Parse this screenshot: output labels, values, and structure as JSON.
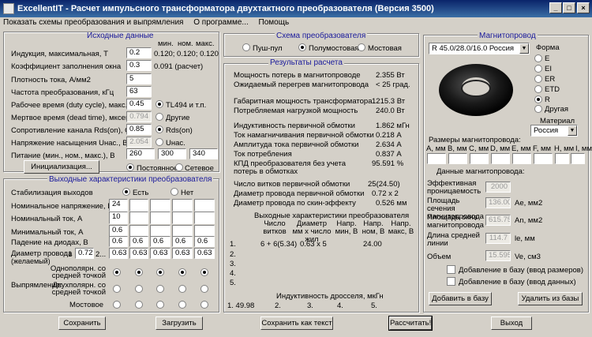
{
  "window": {
    "title": "ExcellentIT - Расчет импульсного трансформатора двухтактного преобразователя (Версия 3500)"
  },
  "menu": [
    "Показать схемы преобразования и выпрямления",
    "О программе...",
    "Помощь"
  ],
  "input_panel": {
    "title": "Исходные данные",
    "col_headers": [
      "мин.",
      "ном.",
      "макс."
    ],
    "rows": [
      {
        "label": "Индукция, максимальная, Т",
        "value": "0.2",
        "extra": "0.120; 0.120; 0.120"
      },
      {
        "label": "Коэффициент заполнения окна",
        "value": "0.3",
        "extra": "0.091 (расчет)"
      },
      {
        "label": "Плотность тока, А/мм2",
        "value": "5"
      },
      {
        "label": "Частота преобразования, кГц",
        "value": "63"
      },
      {
        "label": "Рабочее время (duty cycle), макс.",
        "value": "0.45"
      },
      {
        "label": "Мертвое время (dead time), мксек",
        "value": "0.794"
      },
      {
        "label": "Сопротивление канала Rds(on), Ом",
        "value": "0.85"
      },
      {
        "label": "Напряжение насыщения Uнас., В",
        "value": "2.054"
      }
    ],
    "opt1": [
      "TL494 и т.п.",
      "Другие"
    ],
    "opt2": [
      "Rds(on)",
      "Uнас."
    ],
    "supply_label": "Питание (мин., ном., макс.), В",
    "supply": [
      "260",
      "300",
      "340"
    ],
    "init_button": "Инициализация...",
    "supply_type": [
      "Постоянное",
      "Сетевое"
    ]
  },
  "output_panel": {
    "title": "Выходные характеристики преобразователя",
    "stab_label": "Стабилизация выходов",
    "stab_opts": [
      "Есть",
      "Нет"
    ],
    "rows": [
      {
        "label": "Номинальное напряжение, В",
        "values": [
          "24",
          "",
          "",
          "",
          ""
        ]
      },
      {
        "label": "Номинальный ток, А",
        "values": [
          "10",
          "",
          "",
          "",
          ""
        ]
      },
      {
        "label": "Минимальный ток, А",
        "values": [
          "0.6",
          "",
          "",
          "",
          ""
        ]
      },
      {
        "label": "Падение на диодах, В",
        "values": [
          "0.6",
          "0.6",
          "0.6",
          "0.6",
          "0.6"
        ]
      }
    ],
    "wire_label": "Диаметр провода",
    "wire_label2": "(желаемый)",
    "wire_values": [
      "1",
      "0.72",
      "2...",
      "0.63",
      "0.63",
      "0.63",
      "0.63",
      "0.63"
    ],
    "rect_label": "Выпрямление:",
    "rect_opts": [
      "Однополярн. со средней точкой",
      "Двухполярн. со средней точкой",
      "Мостовое"
    ]
  },
  "scheme": {
    "title": "Схема преобразователя",
    "opts": [
      "Пуш-пул",
      "Полумостовая",
      "Мостовая"
    ]
  },
  "results": {
    "title": "Результаты расчета",
    "rows": [
      {
        "label": "Мощность потерь в магнитопроводе",
        "value": "2.355 Вт"
      },
      {
        "label": "Ожидаемый перегрев магнитопровода",
        "value": "< 25 град."
      },
      {
        "label": "Габаритная мощность трансформатора",
        "value": "1215.3 Вт"
      },
      {
        "label": "Потребляемая нагрузкой мощность",
        "value": "240.0 Вт"
      },
      {
        "label": "Индуктивность первичной обмотки",
        "value": "1.862 мГн"
      },
      {
        "label": "Ток намагничивания первичной обмотки",
        "value": "0.218 А"
      },
      {
        "label": "Амплитуда тока первичной обмотки",
        "value": "2.634 А"
      },
      {
        "label": "Ток потребления",
        "value": "0.837 А"
      },
      {
        "label": "КПД преобразователя без учета",
        "value": "95.591 %"
      },
      {
        "label": "потерь в обмотках",
        "value": ""
      },
      {
        "label": "Число витков первичной обмотки",
        "value": "25(24.50)"
      },
      {
        "label": "Диаметр провода первичной обмотки",
        "value": "0.72 x 2"
      },
      {
        "label": "Диаметр провода по скин-эффекту",
        "value": "0.526 мм"
      }
    ],
    "out_title": "Выходные характеристики преобразователя",
    "out_cols": [
      "Число витков",
      "Диаметр мм x число жил",
      "Напр. мин, В",
      "Напр. ном, В",
      "Напр. макс, В"
    ],
    "out_rows": [
      {
        "n": "1.",
        "turns": "6 + 6(5.34)",
        "wire": "0.63 x 5",
        "vmin": "",
        "vnom": "24.00",
        "vmax": ""
      },
      {
        "n": "2.",
        "turns": "",
        "wire": "",
        "vmin": "",
        "vnom": "",
        "vmax": ""
      },
      {
        "n": "3.",
        "turns": "",
        "wire": "",
        "vmin": "",
        "vnom": "",
        "vmax": ""
      },
      {
        "n": "4.",
        "turns": "",
        "wire": "",
        "vmin": "",
        "vnom": "",
        "vmax": ""
      },
      {
        "n": "5.",
        "turns": "",
        "wire": "",
        "vmin": "",
        "vnom": "",
        "vmax": ""
      }
    ],
    "choke_title": "Индуктивность дросселя, мкГн",
    "choke": [
      "1. 49.98",
      "2.",
      "3.",
      "4.",
      "5."
    ]
  },
  "core": {
    "title": "Магнитопровод",
    "selected": "R 45.0/28.0/16.0 Россия",
    "shape_label": "Форма",
    "shapes": [
      "E",
      "EI",
      "ER",
      "ETD",
      "R",
      "Другая"
    ],
    "material_label": "Материал",
    "material": "Россия",
    "dims_label": "Размеры магнитопровода:",
    "dims_cols": [
      "A, мм",
      "B, мм",
      "C, мм",
      "D, мм",
      "E, мм",
      "F, мм",
      "H, мм",
      "I, мм"
    ],
    "data_label": "Данные магнитопровода:",
    "params": [
      {
        "label": "Эффективная проницаемость",
        "value": "2000",
        "unit": ""
      },
      {
        "label": "Площадь сечения магнитопровода",
        "value": "136.00",
        "unit": "Ae, мм2"
      },
      {
        "label": "Площадь окна магнитопровода",
        "value": "615.75",
        "unit": "An, мм2"
      },
      {
        "label": "Длина средней линии",
        "value": "114.7",
        "unit": "le, мм"
      },
      {
        "label": "Объем",
        "value": "15.595",
        "unit": "Ve, см3"
      }
    ],
    "chk1": "Добавление в базу (ввод размеров)",
    "chk2": "Добавление в базу (ввод данных)",
    "add_button": "Добавить в базу",
    "del_button": "Удалить из базы"
  },
  "buttons": {
    "save": "Сохранить",
    "load": "Загрузить",
    "save_text": "Сохранить как текст",
    "calc": "Рассчитать!",
    "exit": "Выход"
  }
}
